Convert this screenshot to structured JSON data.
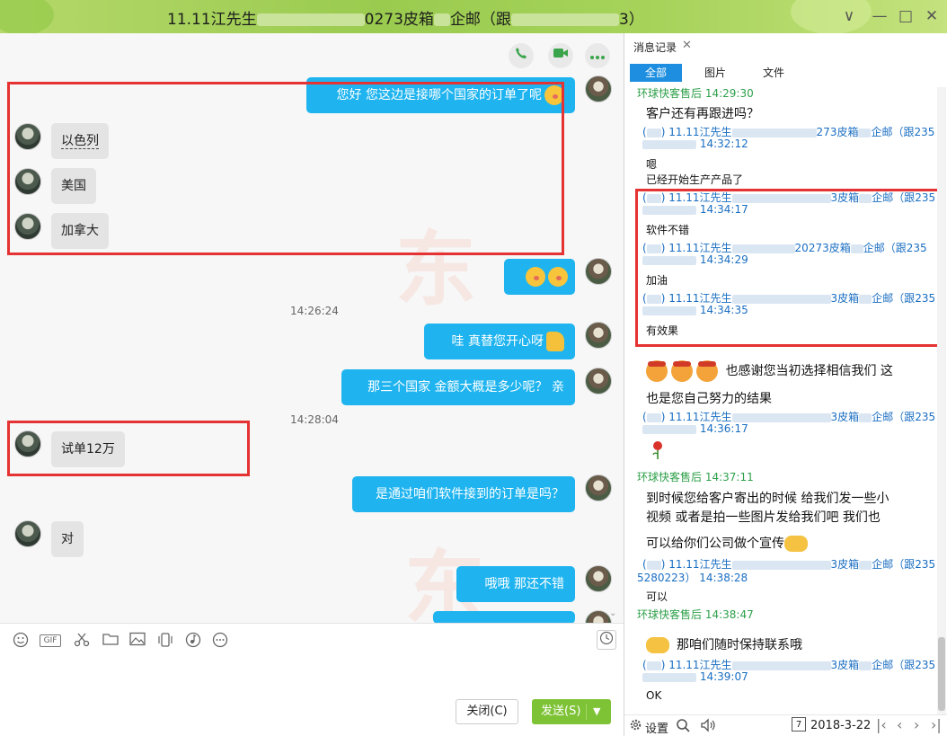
{
  "window": {
    "title_prefix": "11.11江先生",
    "title_mid": "0273皮箱",
    "title_suffix": "企邮（跟",
    "title_end": "3）",
    "minimize_label": "—",
    "maximize_label": "□",
    "close_label": "✕",
    "chevron_label": "∨"
  },
  "chat": {
    "call_icons": [
      "phone-icon",
      "video-icon",
      "more-icon"
    ],
    "messages": [
      {
        "side": "out",
        "text": "您好  您这边是接哪个国家的订单了呢"
      },
      {
        "side": "in",
        "text": "以色列"
      },
      {
        "side": "in",
        "text": "美国"
      },
      {
        "side": "in",
        "text": "加拿大"
      },
      {
        "side": "out",
        "text": ""
      },
      {
        "side": "time",
        "text": "14:26:24"
      },
      {
        "side": "out",
        "text": "哇   真替您开心呀"
      },
      {
        "side": "out",
        "text": "那三个国家 金额大概是多少呢？  亲"
      },
      {
        "side": "time",
        "text": "14:28:04"
      },
      {
        "side": "in",
        "text": "试单12万"
      },
      {
        "side": "out",
        "text": "是通过咱们软件接到的订单是吗？"
      },
      {
        "side": "in",
        "text": "对"
      },
      {
        "side": "out",
        "text": "哦哦  那还不错"
      }
    ],
    "watermark": "东"
  },
  "toolbar": {
    "icons": [
      "emoji-icon",
      "gif-icon",
      "scissors-icon",
      "folder-icon",
      "image-icon",
      "phone-shake-icon",
      "music-icon",
      "more-icon"
    ],
    "gif_label": "GIF",
    "close_label": "关闭(C)",
    "send_label": "发送(S)"
  },
  "history": {
    "title": "消息记录",
    "tabs": [
      "全部",
      "图片",
      "文件"
    ],
    "entries": [
      {
        "kind": "green",
        "text": "环球快客售后 14:29:30"
      },
      {
        "kind": "body",
        "text": "客户还有再跟进吗？"
      },
      {
        "kind": "blue",
        "text": "11.11江先生"
      },
      {
        "kind": "blue_tail",
        "text": "273皮箱"
      },
      {
        "kind": "blue_tail2",
        "text": "企邮（跟235"
      },
      {
        "kind": "blue2",
        "text": "14:32:12"
      },
      {
        "kind": "small",
        "text": "嗯"
      },
      {
        "kind": "small",
        "text": "已经开始生产产品了"
      },
      {
        "kind": "blue",
        "text": "11.11江先生"
      },
      {
        "kind": "blue_tail",
        "text": "3皮箱"
      },
      {
        "kind": "blue_tail2",
        "text": "企邮（跟235"
      },
      {
        "kind": "blue2",
        "text": "14:34:17"
      },
      {
        "kind": "small",
        "text": "软件不错"
      },
      {
        "kind": "blue",
        "text": "11.11江先生"
      },
      {
        "kind": "blue_tail",
        "text": "20273皮箱"
      },
      {
        "kind": "blue_tail2",
        "text": "企邮（跟235"
      },
      {
        "kind": "blue2",
        "text": "14:34:29"
      },
      {
        "kind": "small",
        "text": "加油"
      },
      {
        "kind": "blue",
        "text": "11.11江先生"
      },
      {
        "kind": "blue_tail",
        "text": "3皮箱"
      },
      {
        "kind": "blue_tail2",
        "text": "企邮（跟235"
      },
      {
        "kind": "blue2",
        "text": "14:34:35"
      },
      {
        "kind": "small",
        "text": "有效果"
      },
      {
        "kind": "body",
        "text": "也感谢您当初选择相信我们   这"
      },
      {
        "kind": "body",
        "text": "也是您自己努力的结果"
      },
      {
        "kind": "blue",
        "text": "11.11江先生"
      },
      {
        "kind": "blue_tail",
        "text": "3皮箱"
      },
      {
        "kind": "blue_tail2",
        "text": "企邮（跟235"
      },
      {
        "kind": "blue2",
        "text": "14:36:17"
      },
      {
        "kind": "green",
        "text": "环球快客售后 14:37:11"
      },
      {
        "kind": "body",
        "text": "到时候您给客户寄出的时候  给我们发一些小"
      },
      {
        "kind": "body",
        "text": "视频 或者是拍一些图片发给我们吧    我们也"
      },
      {
        "kind": "body",
        "text": "可以给你们公司做个宣传"
      },
      {
        "kind": "blue",
        "text": "11.11江先生"
      },
      {
        "kind": "blue_tail",
        "text": "3皮箱"
      },
      {
        "kind": "blue_tail2",
        "text": "企邮（跟235"
      },
      {
        "kind": "blue2",
        "text": "5280223）  14:38:28"
      },
      {
        "kind": "small",
        "text": "可以"
      },
      {
        "kind": "green",
        "text": "环球快客售后 14:38:47"
      },
      {
        "kind": "body",
        "text": "那咱们随时保持联系哦"
      },
      {
        "kind": "blue",
        "text": "11.11江先生"
      },
      {
        "kind": "blue_tail",
        "text": "3皮箱"
      },
      {
        "kind": "blue_tail2",
        "text": "企邮（跟235"
      },
      {
        "kind": "blue2",
        "text": "14:39:07"
      },
      {
        "kind": "small",
        "text": "OK"
      }
    ],
    "footer": {
      "settings_label": "设置",
      "date": "2018-3-22",
      "calendar_day": "7"
    }
  }
}
